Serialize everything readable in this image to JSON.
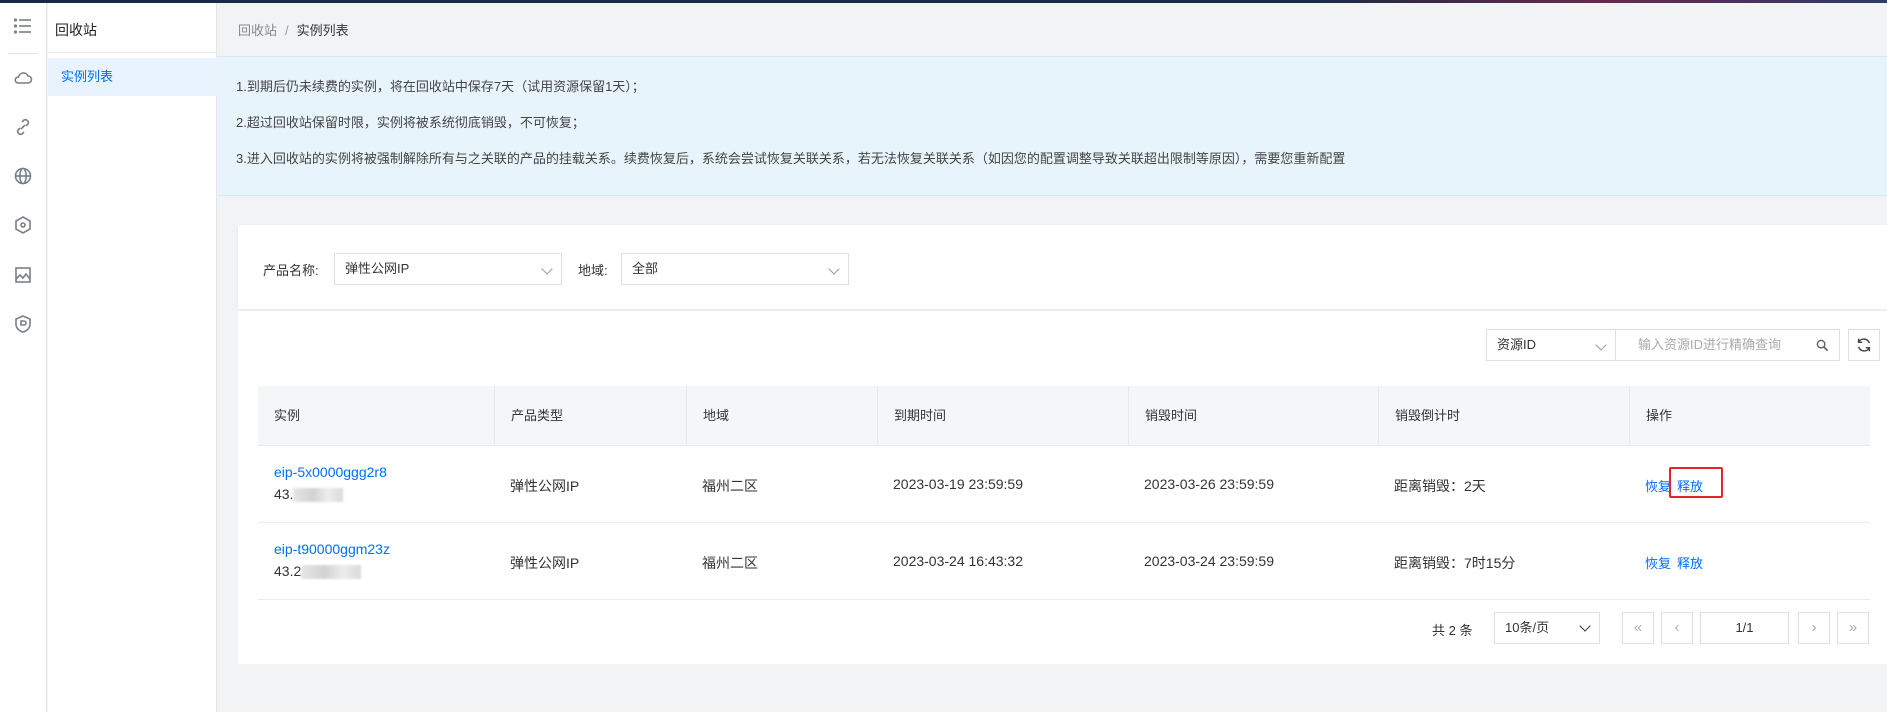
{
  "rail": {
    "icons": [
      "menu-icon",
      "cloud-icon",
      "link-icon",
      "globe-icon",
      "network-icon",
      "image-icon",
      "shield-icon"
    ]
  },
  "subnav": {
    "title": "回收站",
    "items": [
      {
        "label": "实例列表"
      }
    ]
  },
  "breadcrumb": {
    "root": "回收站",
    "separator": "/",
    "current": "实例列表"
  },
  "notice": {
    "lines": [
      "1.到期后仍未续费的实例，将在回收站中保存7天（试用资源保留1天）；",
      "2.超过回收站保留时限，实例将被系统彻底销毁，不可恢复；",
      "3.进入回收站的实例将被强制解除所有与之关联的产品的挂载关系。续费恢复后，系统会尝试恢复关联关系，若无法恢复关联关系（如因您的配置调整导致关联超出限制等原因），需要您重新配置"
    ]
  },
  "filters": {
    "product_label": "产品名称:",
    "product_value": "弹性公网IP",
    "region_label": "地域:",
    "region_value": "全部"
  },
  "toolbar": {
    "search_type": "资源ID",
    "search_placeholder": "输入资源ID进行精确查询"
  },
  "table": {
    "columns": [
      "实例",
      "产品类型",
      "地域",
      "到期时间",
      "销毁时间",
      "销毁倒计时",
      "操作"
    ],
    "rows": [
      {
        "id": "eip-5x0000ggg2r8",
        "ip_prefix": "43.",
        "type": "弹性公网IP",
        "region": "福州二区",
        "expire": "2023-03-19 23:59:59",
        "destroy": "2023-03-26 23:59:59",
        "countdown": "距离销毁：2天",
        "action_restore": "恢复",
        "action_release": "释放"
      },
      {
        "id": "eip-t90000ggm23z",
        "ip_prefix": "43.2",
        "type": "弹性公网IP",
        "region": "福州二区",
        "expire": "2023-03-24 16:43:32",
        "destroy": "2023-03-24 23:59:59",
        "countdown": "距离销毁：7时15分",
        "action_restore": "恢复",
        "action_release": "释放"
      }
    ]
  },
  "pagination": {
    "total": "共 2 条",
    "page_size": "10条/页",
    "page": "1/1"
  },
  "colors": {
    "accent": "#006eff",
    "highlight": "#e5242a"
  }
}
